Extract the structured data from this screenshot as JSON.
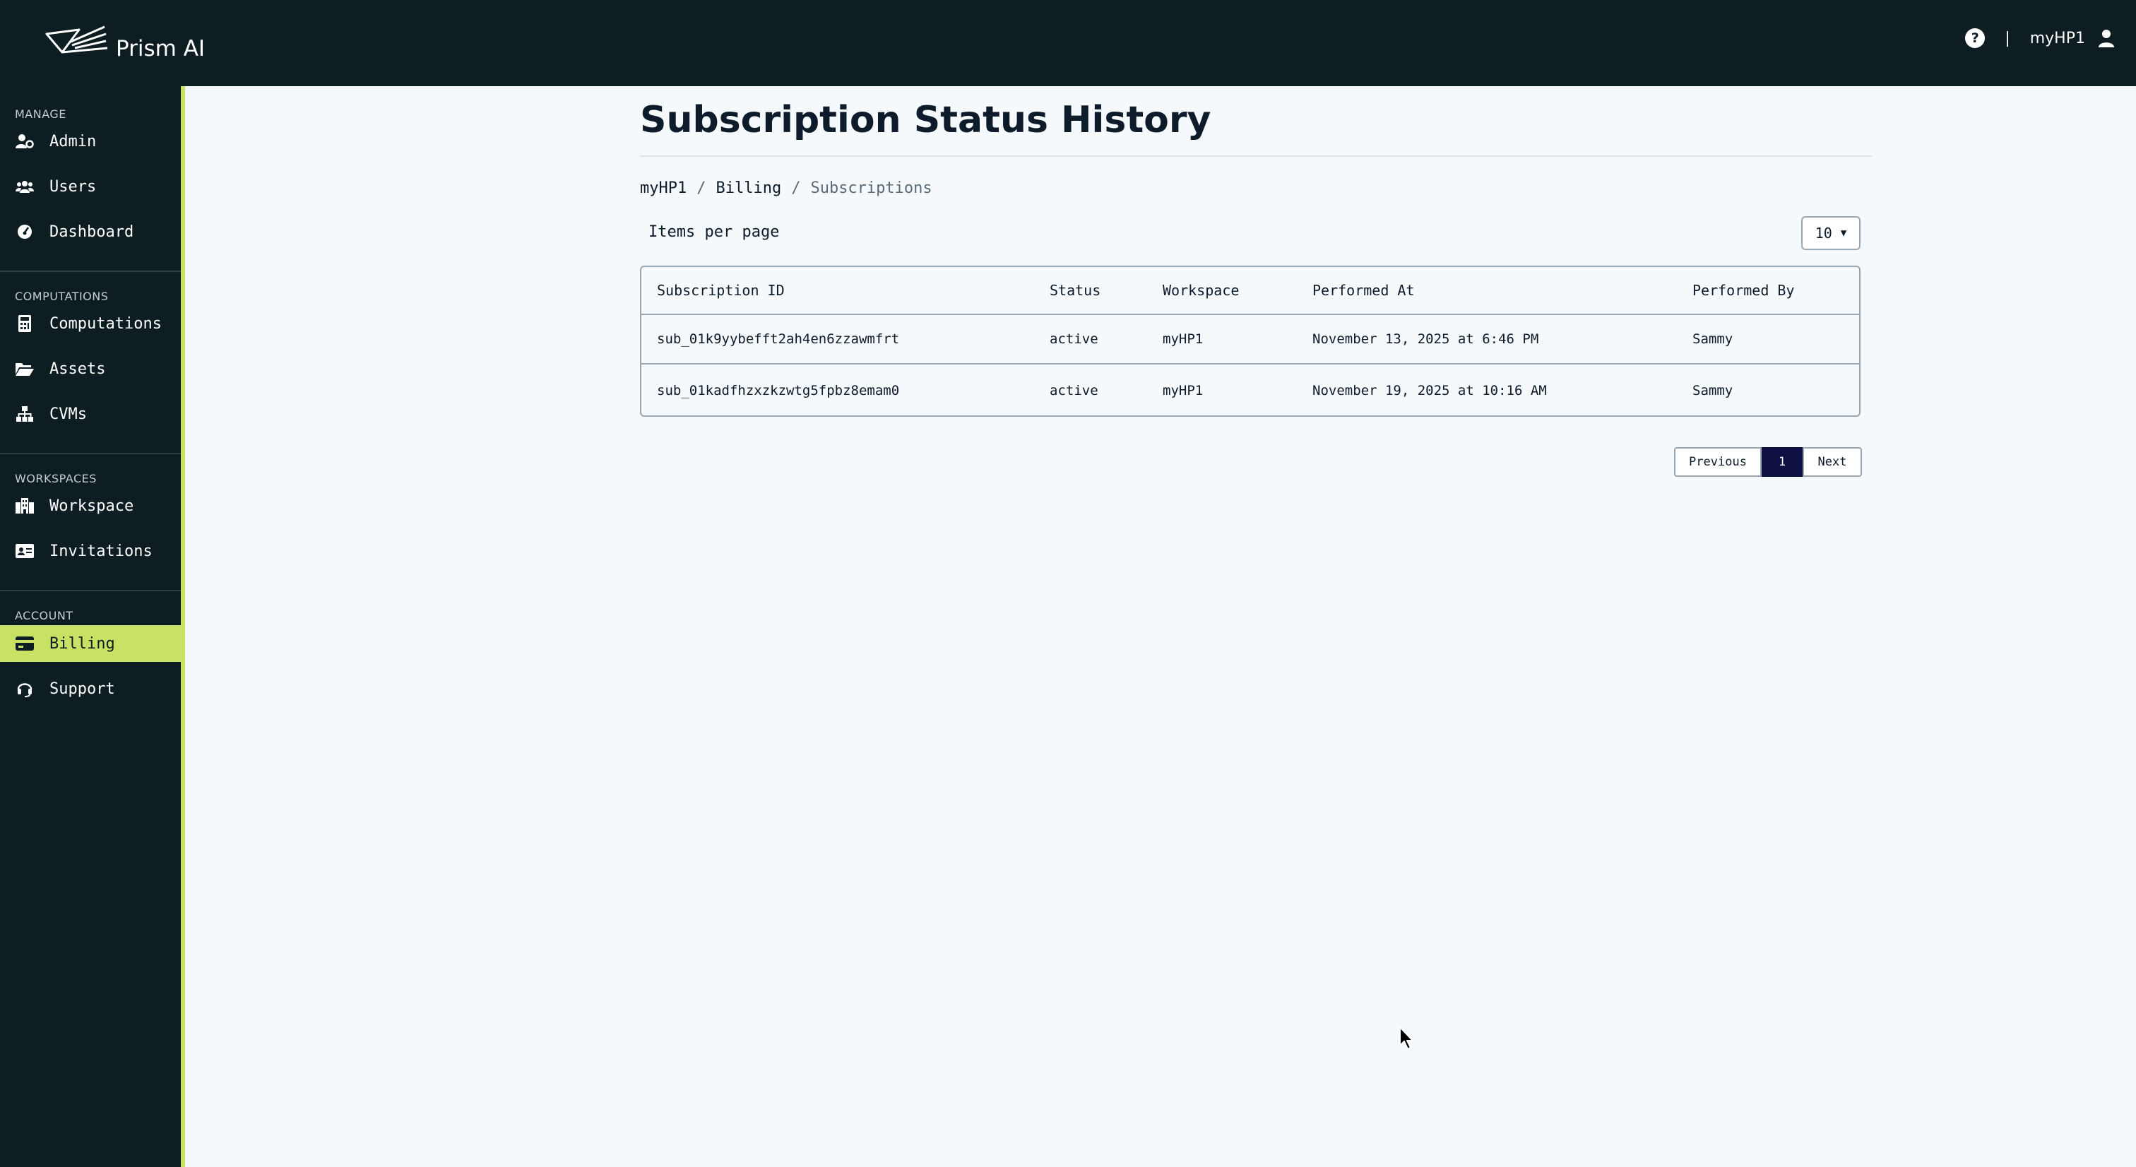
{
  "header": {
    "brand_name": "Prism AI",
    "help_icon": "?",
    "separator": "|",
    "user_name": "myHP1"
  },
  "sidebar": {
    "sections": [
      {
        "title": "MANAGE",
        "items": [
          {
            "label": "Admin",
            "icon": "user-gear-icon"
          },
          {
            "label": "Users",
            "icon": "users-icon"
          },
          {
            "label": "Dashboard",
            "icon": "gauge-icon"
          }
        ]
      },
      {
        "title": "COMPUTATIONS",
        "items": [
          {
            "label": "Computations",
            "icon": "calculator-icon"
          },
          {
            "label": "Assets",
            "icon": "folder-open-icon"
          },
          {
            "label": "CVMs",
            "icon": "sitemap-icon"
          }
        ]
      },
      {
        "title": "WORKSPACES",
        "items": [
          {
            "label": "Workspace",
            "icon": "building-icon"
          },
          {
            "label": "Invitations",
            "icon": "id-card-icon"
          }
        ]
      },
      {
        "title": "ACCOUNT",
        "items": [
          {
            "label": "Billing",
            "icon": "credit-card-icon",
            "active": true
          },
          {
            "label": "Support",
            "icon": "headset-icon"
          }
        ]
      }
    ]
  },
  "main": {
    "title": "Subscription Status History",
    "breadcrumb": [
      "myHP1",
      "Billing",
      "Subscriptions"
    ],
    "breadcrumb_separator": "/",
    "items_per_page_label": "Items per page",
    "items_per_page_value": "10",
    "table": {
      "columns": [
        "Subscription ID",
        "Status",
        "Workspace",
        "Performed At",
        "Performed By"
      ],
      "rows": [
        [
          "sub_01k9yybefft2ah4en6zzawmfrt",
          "active",
          "myHP1",
          "November 13, 2025 at 6:46 PM",
          "Sammy"
        ],
        [
          "sub_01kadfhzxzkzwtg5fpbz8emam0",
          "active",
          "myHP1",
          "November 19, 2025 at 10:16 AM",
          "Sammy"
        ]
      ]
    },
    "pagination": {
      "previous": "Previous",
      "current": "1",
      "next": "Next"
    }
  },
  "colors": {
    "sidebar_bg": "#0d1d22",
    "accent": "#c9e265",
    "page_bg": "#f5f9fc",
    "current_page_bg": "#0d1040"
  }
}
